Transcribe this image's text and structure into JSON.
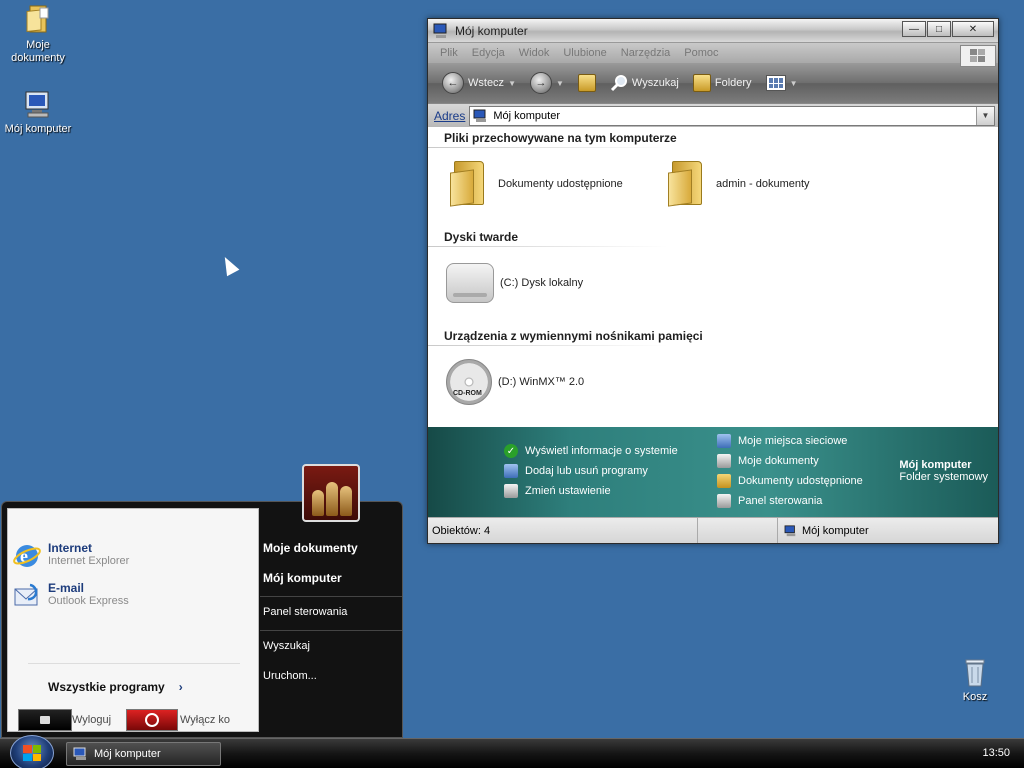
{
  "desktop": {
    "icons": [
      {
        "label": "Moje dokumenty"
      },
      {
        "label": "Mój komputer"
      },
      {
        "label": "Kosz"
      }
    ]
  },
  "window": {
    "title": "Mój komputer",
    "menu": [
      "Plik",
      "Edycja",
      "Widok",
      "Ulubione",
      "Narzędzia",
      "Pomoc"
    ],
    "toolbar": {
      "back": "Wstecz",
      "search": "Wyszukaj",
      "folders": "Foldery"
    },
    "address": {
      "label": "Adres",
      "value": "Mój komputer"
    },
    "groups": [
      {
        "title": "Pliki przechowywane na tym komputerze",
        "items": [
          "Dokumenty udostępnione",
          "admin - dokumenty"
        ]
      },
      {
        "title": "Dyski twarde",
        "items": [
          "(C:) Dysk lokalny"
        ]
      },
      {
        "title": "Urządzenia z wymiennymi nośnikami pamięci",
        "items": [
          "(D:) WinMX™ 2.0"
        ]
      }
    ],
    "cd_label": "CD-ROM",
    "tasks_left": [
      "Wyświetl informacje o systemie",
      "Dodaj lub usuń programy",
      "Zmień ustawienie"
    ],
    "tasks_right": [
      "Moje miejsca sieciowe",
      "Moje dokumenty",
      "Dokumenty udostępnione",
      "Panel sterowania"
    ],
    "details": {
      "name": "Mój komputer",
      "type": "Folder systemowy"
    },
    "status": {
      "count": "Obiektów: 4",
      "location": "Mój komputer"
    }
  },
  "startmenu": {
    "pinned": [
      {
        "title": "Internet",
        "subtitle": "Internet Explorer"
      },
      {
        "title": "E-mail",
        "subtitle": "Outlook Express"
      }
    ],
    "all_programs": "Wszystkie programy",
    "right": [
      "Moje dokumenty",
      "Mój komputer",
      "Panel sterowania",
      "Wyszukaj",
      "Uruchom..."
    ],
    "logoff": "Wyloguj",
    "shutdown": "Wyłącz ko"
  },
  "taskbar": {
    "button": "Mój komputer",
    "clock": "13:50"
  }
}
